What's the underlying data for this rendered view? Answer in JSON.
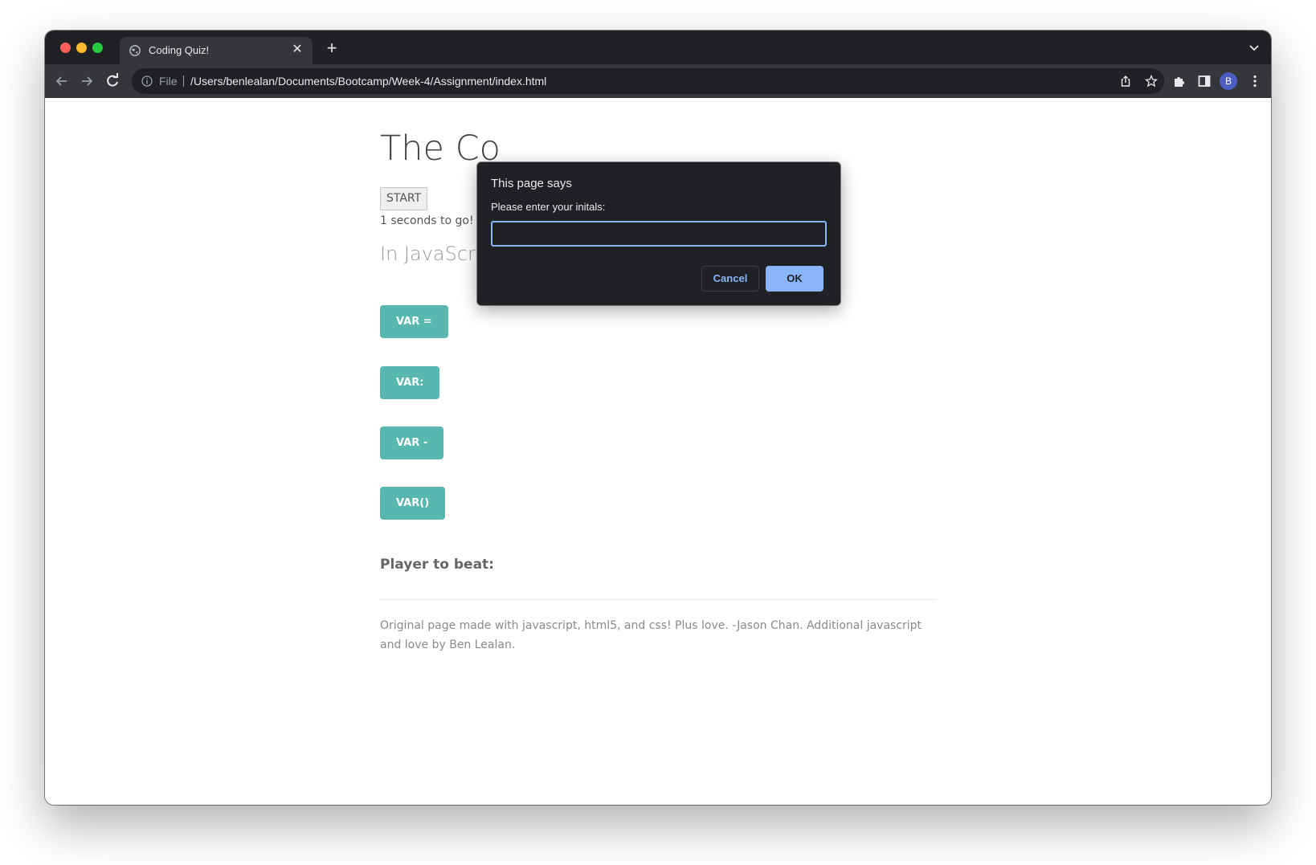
{
  "browser": {
    "tab": {
      "title": "Coding Quiz!",
      "close_icon": "close-icon",
      "favicon_icon": "globe-icon"
    },
    "new_tab_icon": "plus-icon",
    "tab_search_icon": "chevron-down-icon",
    "toolbar": {
      "back_icon": "arrow-left-icon",
      "forward_icon": "arrow-right-icon",
      "reload_icon": "reload-icon",
      "extensions_icon": "puzzle-icon",
      "side_panel_icon": "side-panel-icon",
      "profile_initial": "B",
      "menu_icon": "kebab-menu-icon"
    },
    "omnibox": {
      "info_icon": "info-icon",
      "scheme_label": "File",
      "url": "/Users/benlealan/Documents/Bootcamp/Week-4/Assignment/index.html",
      "share_icon": "share-icon",
      "bookmark_icon": "star-icon"
    },
    "colors": {
      "frame": "#202124",
      "toolbar": "#35363a",
      "accent": "#8ab4f8"
    }
  },
  "page": {
    "title": "The Co",
    "start_label": "START",
    "timer_text": "1 seconds to go!",
    "question": "In JavaScript how do you declare a variable?",
    "answers": [
      "VAR =",
      "VAR:",
      "VAR -",
      "VAR()"
    ],
    "player_to_beat": "Player to beat:",
    "footer": "Original page made with javascript, html5, and css! Plus love. -Jason Chan. Additional javascript and love by Ben Lealan.",
    "colors": {
      "answer_button": "#58b8b0"
    }
  },
  "dialog": {
    "title": "This page says",
    "message": "Please enter your initals:",
    "input_value": "",
    "cancel_label": "Cancel",
    "ok_label": "OK"
  }
}
